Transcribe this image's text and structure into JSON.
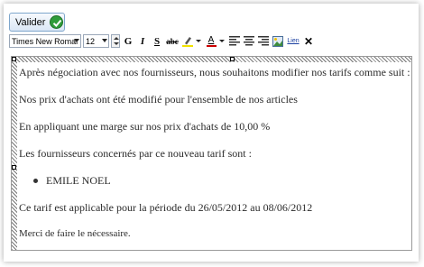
{
  "toolbar": {
    "valider_label": "Valider",
    "font_family": "Times New Romar",
    "font_size": "12",
    "bold": "G",
    "italic": "I",
    "underline": "S",
    "strike": "abc",
    "text_color": "A",
    "link": "Lien",
    "close": "✕"
  },
  "editor": {
    "lines": [
      "Après négociation avec nos fournisseurs, nous souhaitons modifier nos tarifs comme suit :",
      "Nos prix d'achats ont été modifié pour l'ensemble de nos articles",
      "En appliquant une marge sur nos prix d'achats de  10,00 %",
      "Les fournisseurs concernés par ce nouveau tarif sont :",
      "Ce tarif est applicable pour la période du 26/05/2012 au 08/06/2012",
      "Merci de faire le nécessaire."
    ],
    "bullets": [
      "EMILE NOEL"
    ]
  },
  "colors": {
    "accent_green": "#2f9c3a",
    "button_border": "#7ea6cc",
    "highlight_yellow": "#f2e200",
    "text_red": "#cc0000"
  }
}
